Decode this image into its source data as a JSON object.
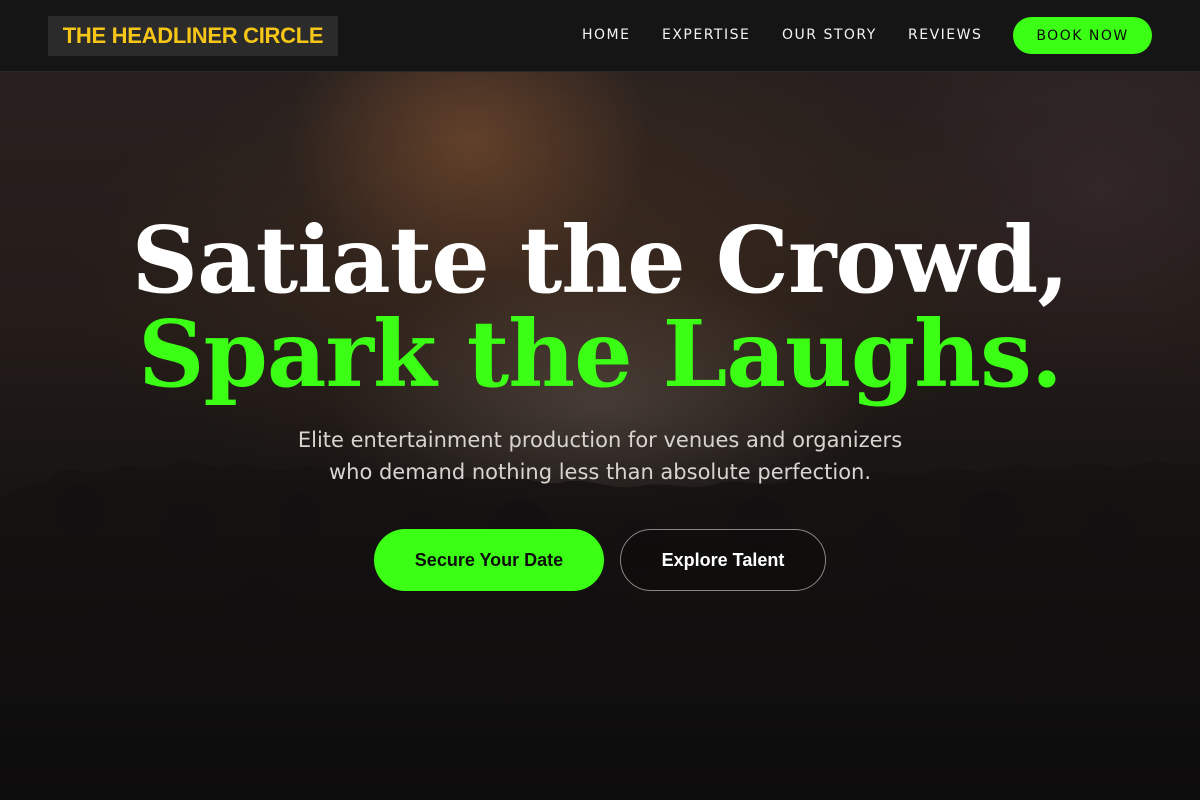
{
  "header": {
    "logo_text": "THE HEADLINER CIRCLE",
    "nav": [
      {
        "label": "HOME"
      },
      {
        "label": "EXPERTISE"
      },
      {
        "label": "OUR STORY"
      },
      {
        "label": "REVIEWS"
      }
    ],
    "cta_label": "BOOK NOW"
  },
  "hero": {
    "headline_line1": "Satiate the Crowd,",
    "headline_line2": "Spark the Laughs.",
    "subtext_line1": "Elite entertainment production for venues and organizers",
    "subtext_line2": "who demand nothing less than absolute perfection.",
    "primary_button": "Secure Your Date",
    "secondary_button": "Explore Talent",
    "background_image": "concert-crowd-photo"
  },
  "colors": {
    "accent": "#3bff14",
    "logo": "#f5c518",
    "header_bg": "#151515",
    "hero_bg": "#1d1a19"
  }
}
